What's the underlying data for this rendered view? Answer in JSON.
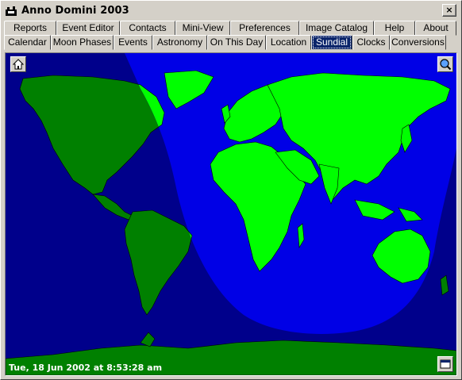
{
  "window": {
    "title": "Anno Domini 2003",
    "close_label": "×"
  },
  "tabs_row1": [
    "Reports",
    "Event Editor",
    "Contacts",
    "Mini-View",
    "Preferences",
    "Image Catalog",
    "Help",
    "About"
  ],
  "tabs_row2": [
    "Calendar",
    "Moon Phases",
    "Events",
    "Astronomy",
    "On This Day",
    "Location",
    "Sundial",
    "Clocks",
    "Conversions"
  ],
  "active_tab": "Sundial",
  "map": {
    "datetime": "Tue, 18 Jun 2002 at 8:53:28 am",
    "colors": {
      "night_ocean": "#00008b",
      "day_ocean": "#0000e6",
      "day_land": "#00ff00",
      "night_land": "#008000"
    },
    "buttons": [
      "home-icon",
      "zoom-icon",
      "window-icon"
    ]
  }
}
